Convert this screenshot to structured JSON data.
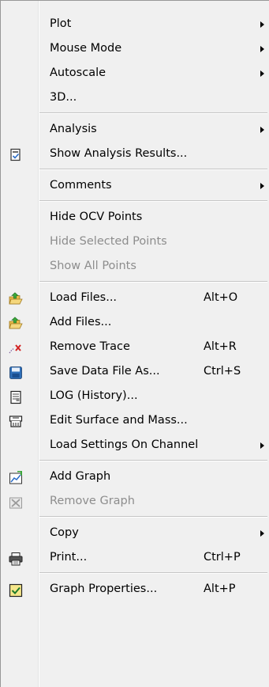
{
  "menu": {
    "groups": [
      {
        "items": [
          {
            "label": "Plot",
            "submenu": true,
            "enabled": true,
            "icon": ""
          },
          {
            "label": "Mouse Mode",
            "submenu": true,
            "enabled": true,
            "icon": ""
          },
          {
            "label": "Autoscale",
            "submenu": true,
            "enabled": true,
            "icon": ""
          },
          {
            "label": "3D...",
            "submenu": false,
            "enabled": true,
            "icon": ""
          }
        ]
      },
      {
        "items": [
          {
            "label": "Analysis",
            "submenu": true,
            "enabled": true,
            "icon": ""
          },
          {
            "label": "Show Analysis Results...",
            "submenu": false,
            "enabled": true,
            "icon": "analysis-results-icon"
          }
        ]
      },
      {
        "items": [
          {
            "label": "Comments",
            "submenu": true,
            "enabled": true,
            "icon": ""
          }
        ]
      },
      {
        "items": [
          {
            "label": "Hide OCV Points",
            "submenu": false,
            "enabled": true,
            "icon": ""
          },
          {
            "label": "Hide Selected Points",
            "submenu": false,
            "enabled": false,
            "icon": ""
          },
          {
            "label": "Show All Points",
            "submenu": false,
            "enabled": false,
            "icon": ""
          }
        ]
      },
      {
        "items": [
          {
            "label": "Load Files...",
            "shortcut": "Alt+O",
            "submenu": false,
            "enabled": true,
            "icon": "open-folder-icon"
          },
          {
            "label": "Add Files...",
            "submenu": false,
            "enabled": true,
            "icon": "add-folder-icon"
          },
          {
            "label": "Remove Trace",
            "shortcut": "Alt+R",
            "submenu": false,
            "enabled": true,
            "icon": "remove-trace-icon"
          },
          {
            "label": "Save Data File As...",
            "shortcut": "Ctrl+S",
            "submenu": false,
            "enabled": true,
            "icon": "save-disk-icon"
          },
          {
            "label": "LOG (History)...",
            "submenu": false,
            "enabled": true,
            "icon": "log-document-icon"
          },
          {
            "label": "Edit Surface and Mass...",
            "submenu": false,
            "enabled": true,
            "icon": "surface-mass-icon"
          },
          {
            "label": "Load Settings On Channel",
            "submenu": true,
            "enabled": true,
            "icon": ""
          }
        ]
      },
      {
        "items": [
          {
            "label": "Add Graph",
            "submenu": false,
            "enabled": true,
            "icon": "add-graph-icon"
          },
          {
            "label": "Remove Graph",
            "submenu": false,
            "enabled": false,
            "icon": "remove-graph-icon"
          }
        ]
      },
      {
        "items": [
          {
            "label": "Copy",
            "submenu": true,
            "enabled": true,
            "icon": ""
          },
          {
            "label": "Print...",
            "shortcut": "Ctrl+P",
            "submenu": false,
            "enabled": true,
            "icon": "printer-icon"
          }
        ]
      },
      {
        "items": [
          {
            "label": "Graph Properties...",
            "shortcut": "Alt+P",
            "submenu": false,
            "enabled": true,
            "icon": "graph-properties-icon"
          }
        ]
      }
    ]
  }
}
